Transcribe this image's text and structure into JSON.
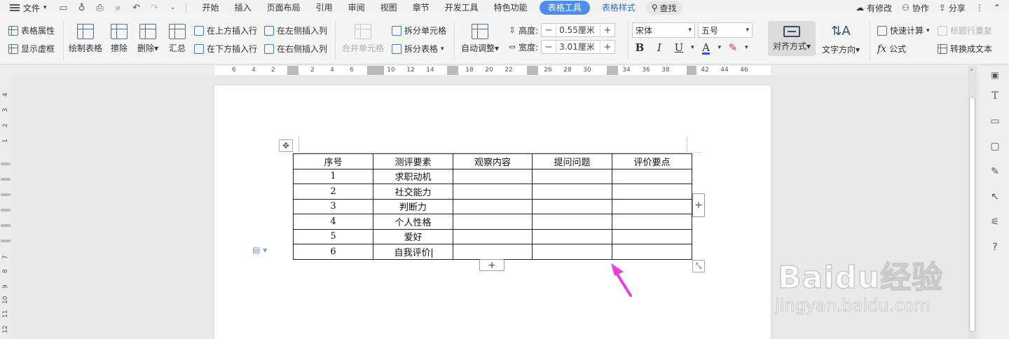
{
  "menubar": {
    "file_label": "文件",
    "tabs": [
      "开始",
      "插入",
      "页面布局",
      "引用",
      "审阅",
      "视图",
      "章节",
      "开发工具",
      "特色功能"
    ],
    "active_tab": "表格工具",
    "style_tab": "表格样式",
    "search_label": "查找",
    "right": {
      "modified": "有修改",
      "collab": "协作",
      "share": "分享"
    }
  },
  "ribbon": {
    "table_props": "表格属性",
    "show_grid": "显示虚框",
    "draw_table": "绘制表格",
    "erase": "擦除",
    "delete": "删除",
    "summary": "汇总",
    "insert_above": "在上方插入行",
    "insert_below": "在下方插入行",
    "insert_left": "在左侧插入列",
    "insert_right": "在右侧插入列",
    "merge_cells": "合并单元格",
    "split_cell": "拆分单元格",
    "split_table": "拆分表格",
    "auto_adjust": "自动调整",
    "height_label": "高度:",
    "height_value": "0.55厘米",
    "width_label": "宽度:",
    "width_value": "3.01厘米",
    "font_name": "宋体",
    "font_size": "五号",
    "align_mode": "对齐方式",
    "text_direction": "文字方向",
    "quick_calc": "快速计算",
    "repeat_header": "标题行重复",
    "formula": "公式",
    "to_text": "转换成文本"
  },
  "ruler": {
    "top_marks": [
      "6",
      "4",
      "2",
      "2",
      "4",
      "6",
      "10",
      "12",
      "14",
      "18",
      "20",
      "22",
      "26",
      "28",
      "30",
      "34",
      "36",
      "38",
      "42",
      "44",
      "46"
    ],
    "left_marks": [
      "4",
      "3",
      "2",
      "1",
      "7",
      "8",
      "9",
      "10",
      "11",
      "12"
    ]
  },
  "table": {
    "headers": [
      "序号",
      "测评要素",
      "观察内容",
      "提问问题",
      "评价要点"
    ],
    "rows": [
      [
        "1",
        "求职动机",
        "",
        "",
        ""
      ],
      [
        "2",
        "社交能力",
        "",
        "",
        ""
      ],
      [
        "3",
        "判断力",
        "",
        "",
        ""
      ],
      [
        "4",
        "个人性格",
        "",
        "",
        ""
      ],
      [
        "5",
        "爱好",
        "",
        "",
        ""
      ],
      [
        "6",
        "自我评价",
        "",
        "",
        ""
      ]
    ]
  },
  "watermark": {
    "logo": "Baidu经验",
    "url": "jingyan.baidu.com"
  },
  "colors": {
    "accent": "#4f8ee8",
    "arrow": "#e83fd8",
    "font_color": "#2a52d1",
    "highlight": "#e03a3a"
  }
}
